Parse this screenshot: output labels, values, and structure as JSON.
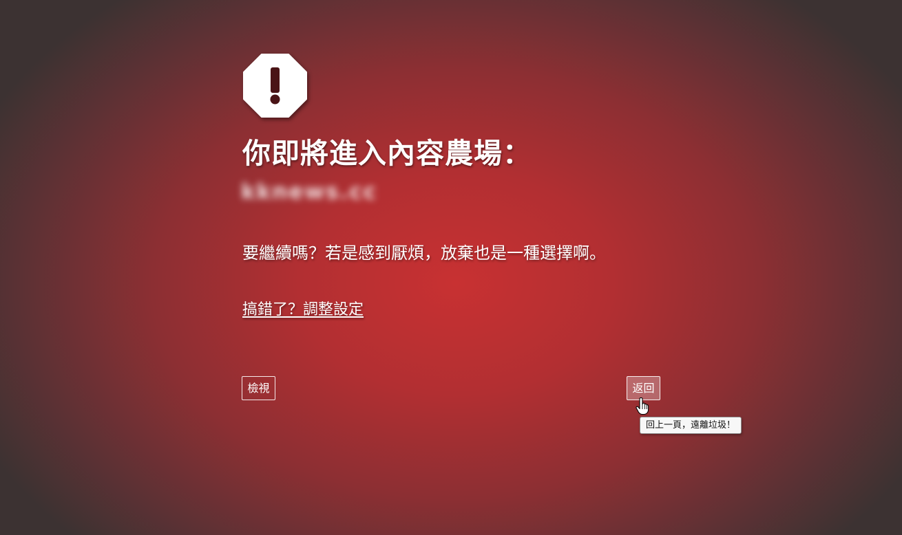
{
  "warning": {
    "icon": "exclamation-octagon-icon",
    "title": "你即將進入內容農場：",
    "site": "kknews.cc",
    "message": "要繼續嗎？若是感到厭煩，放棄也是一種選擇啊。",
    "settings_link": "搞錯了？調整設定"
  },
  "actions": {
    "view_label": "檢視",
    "back_label": "返回",
    "back_tooltip": "回上一頁，遠離垃圾！"
  },
  "cursor": "pointer-hand-icon"
}
